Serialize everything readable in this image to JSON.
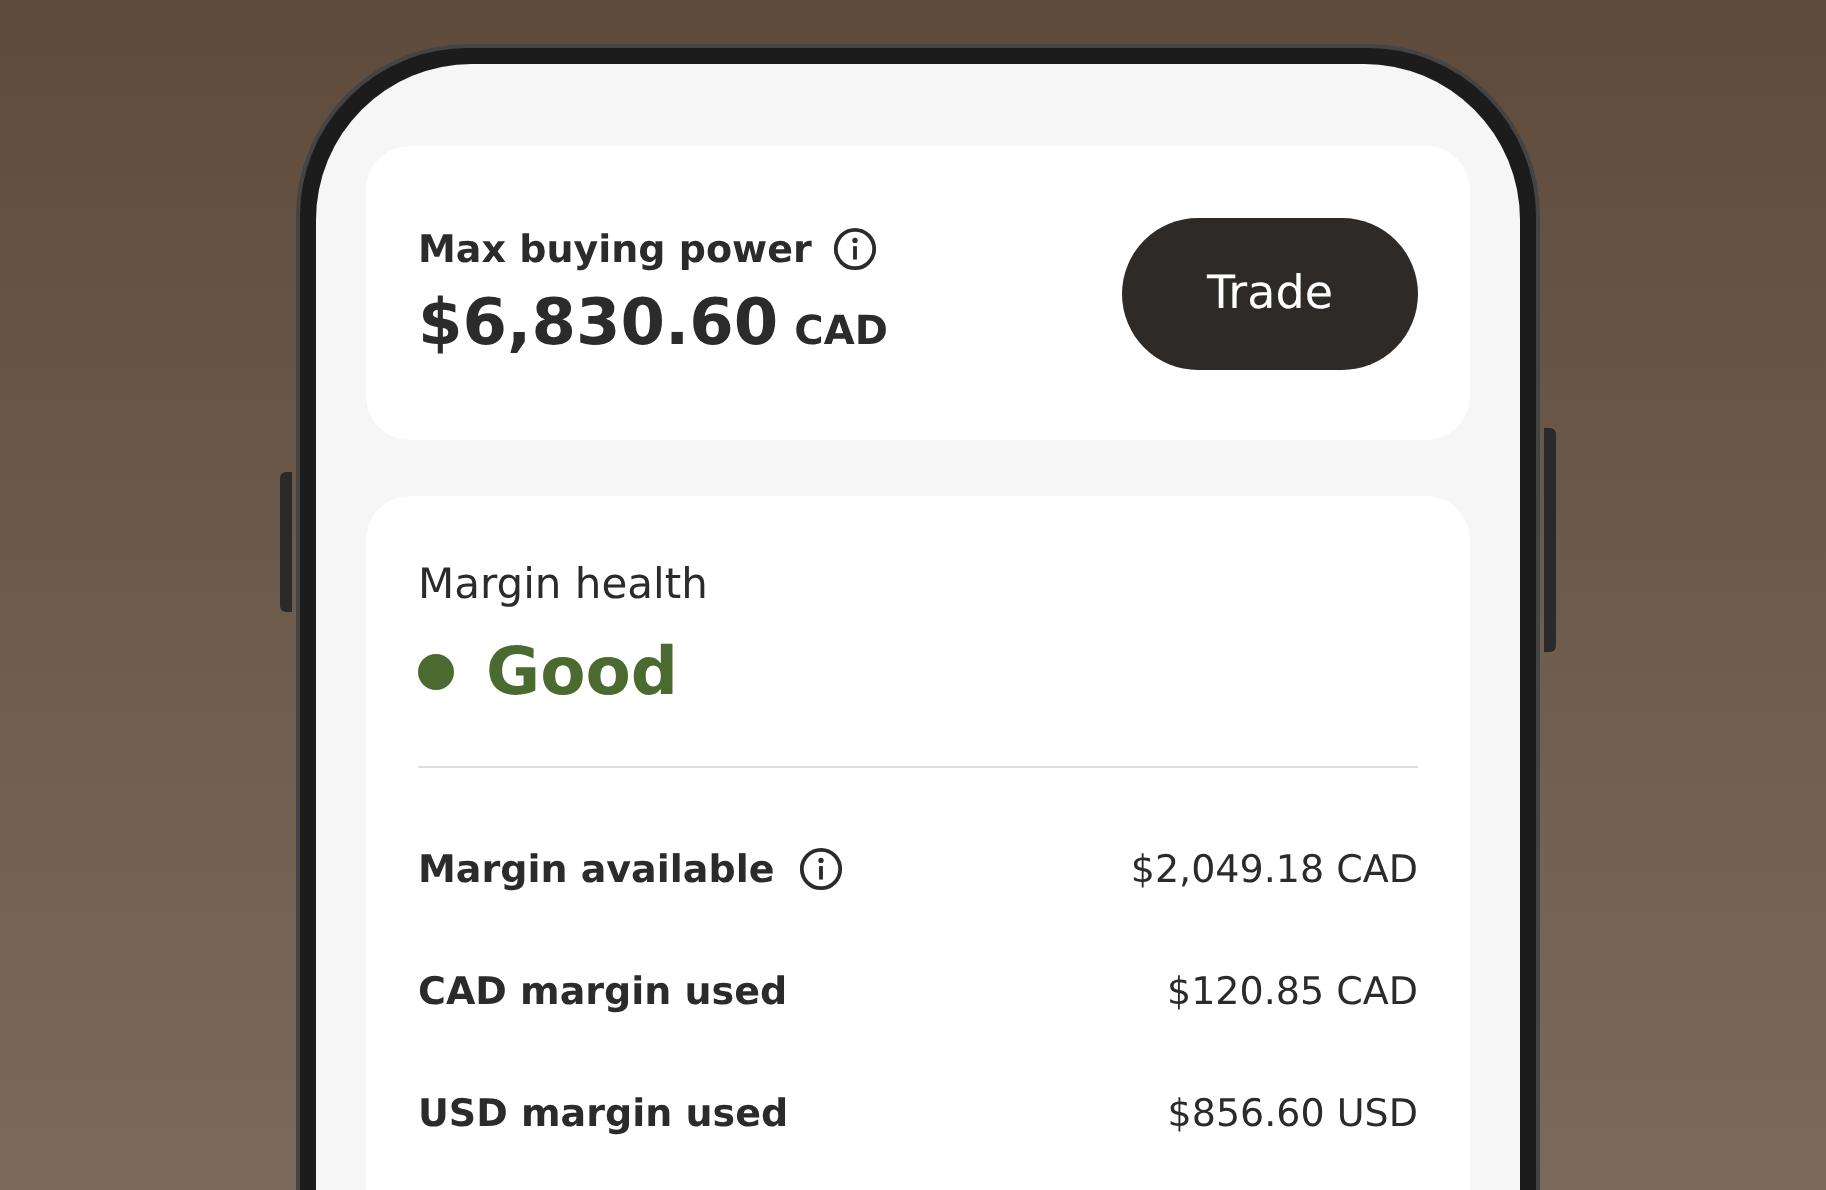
{
  "buying_power": {
    "label": "Max buying power",
    "amount": "$6,830.60",
    "currency": "CAD",
    "button": "Trade"
  },
  "margin_health": {
    "title": "Margin health",
    "status": "Good",
    "color": "#4b6a2f"
  },
  "rows": [
    {
      "label": "Margin available",
      "info": true,
      "value": "$2,049.18 CAD"
    },
    {
      "label": "CAD margin used",
      "info": false,
      "value": "$120.85 CAD"
    },
    {
      "label": "USD margin used",
      "info": false,
      "value": "$856.60 USD"
    }
  ]
}
